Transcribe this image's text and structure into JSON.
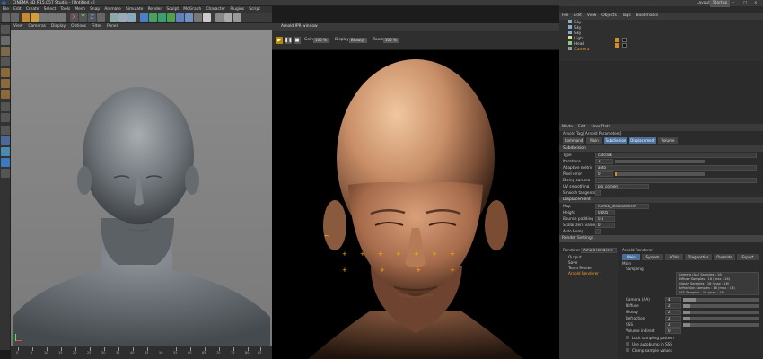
{
  "window": {
    "title": "CINEMA 4D R15.057 Studio - [Untitled 4]",
    "minimize": "–",
    "maximize": "□",
    "close": "×"
  },
  "menubar": [
    "File",
    "Edit",
    "Create",
    "Select",
    "Tools",
    "Mesh",
    "Snap",
    "Animate",
    "Simulate",
    "Render",
    "Sculpt",
    "MoGraph",
    "Character",
    "Plugins",
    "Script",
    "Window",
    "Help"
  ],
  "viewport": {
    "menu": [
      "View",
      "Cameras",
      "Display",
      "Options",
      "Filter",
      "Panel"
    ],
    "label": "Perspective",
    "timeline_ticks": [
      "0",
      "5",
      "10",
      "15",
      "20",
      "25",
      "30",
      "35",
      "40",
      "45",
      "50",
      "55",
      "60",
      "65",
      "70",
      "75",
      "80",
      "85",
      "90"
    ]
  },
  "render_window": {
    "title": "Arnold IPR window",
    "play": "▶",
    "pause": "❚❚",
    "stop": "■",
    "gain_label": "Gain",
    "gain_value": "100 %",
    "display_label": "Display",
    "display_value": "Beauty",
    "zoom_label": "Zoom",
    "zoom_value": "100 %"
  },
  "object_manager": {
    "menu": [
      "File",
      "Edit",
      "View",
      "Objects",
      "Tags",
      "Bookmarks"
    ],
    "layout_label": "Layout",
    "layout_value": "Startup",
    "objects": [
      "Sky",
      "Sky",
      "Sky",
      "Light",
      "Head",
      "Camera"
    ]
  },
  "attributes": {
    "menu": [
      "Mode",
      "Edit",
      "User Data"
    ],
    "header": "Arnold Tag [Arnold Parameters]",
    "tabs": [
      "Command",
      "Main",
      "Subdivision",
      "Displacement",
      "Volume"
    ],
    "selected_tab": "Subdivision",
    "subdivision_section": "Subdivision",
    "rows": [
      {
        "label": "Type",
        "value": "catclark"
      },
      {
        "label": "Iterations",
        "value": "3"
      },
      {
        "label": "Adaptive metric",
        "value": "auto"
      },
      {
        "label": "Pixel error",
        "value": "0"
      },
      {
        "label": "Dicing camera",
        "value": ""
      },
      {
        "label": "UV smoothing",
        "value": "pin_corners"
      },
      {
        "label": "Smooth tangents",
        "value": ""
      }
    ],
    "displacement_section": "Displacement",
    "disp_rows": [
      {
        "label": "Map",
        "value": "normal_displacement"
      },
      {
        "label": "Height",
        "value": "0.005"
      },
      {
        "label": "Bounds padding",
        "value": "0.1"
      },
      {
        "label": "Scalar zero value",
        "value": "0"
      },
      {
        "label": "Auto bump",
        "value": ""
      }
    ]
  },
  "render_settings": {
    "title": "Render Settings",
    "renderer_label": "Renderer",
    "renderer_value": "Arnold Renderer",
    "left_items": [
      "Output",
      "Save",
      "Team Render",
      "Arnold Renderer"
    ],
    "arnold_label": "Arnold Renderer",
    "tabs": [
      "Main",
      "System",
      "AOVs",
      "Diagnostics",
      "Override",
      "Export"
    ],
    "selected_tab": "Main",
    "main_section": "Main",
    "sampling_section": "Sampling",
    "sample_summary": [
      "Camera (AA) Samples : 16",
      "Diffuse Samples : 16 (max : 16)",
      "Glossy Samples : 16 (max : 16)",
      "Refraction Samples : 16 (max : 16)",
      "SSS Samples : 16 (max : 16)"
    ],
    "sample_rows": [
      {
        "label": "Camera (AA)",
        "value": "4"
      },
      {
        "label": "Diffuse",
        "value": "2"
      },
      {
        "label": "Glossy",
        "value": "2"
      },
      {
        "label": "Refraction",
        "value": "2"
      },
      {
        "label": "SSS",
        "value": "2"
      },
      {
        "label": "Volume indirect",
        "value": "0"
      }
    ],
    "checkbox_rows": [
      "Lock sampling pattern",
      "Use autobump in SSS",
      "Clamp sample values"
    ]
  },
  "colors": {
    "accent": "#4a6f9a",
    "marker": "#ffb400"
  }
}
